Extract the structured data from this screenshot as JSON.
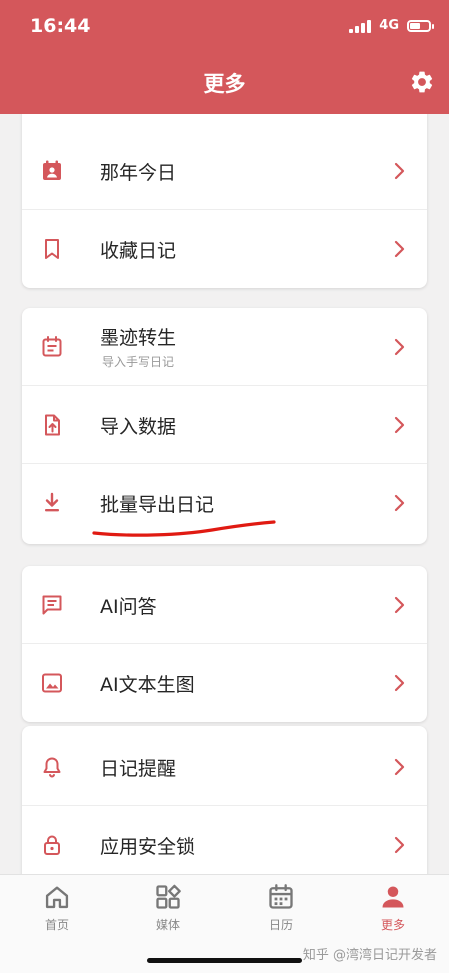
{
  "status_bar": {
    "time": "16:44",
    "network": "4G",
    "battery_level": 0.55
  },
  "header": {
    "title": "更多",
    "settings_icon": "gear-icon"
  },
  "colors": {
    "accent": "#d4575b",
    "text": "#262626",
    "secondary": "#999999",
    "background": "#f2f1f1"
  },
  "groups": [
    {
      "items": [
        {
          "label": "那年今日",
          "icon": "calendar-person-icon"
        },
        {
          "label": "收藏日记",
          "icon": "bookmark-icon"
        }
      ]
    },
    {
      "items": [
        {
          "label": "墨迹转生",
          "subtitle": "导入手写日记",
          "icon": "calendar-notes-icon"
        },
        {
          "label": "导入数据",
          "icon": "file-upload-icon"
        },
        {
          "label": "批量导出日记",
          "icon": "download-icon",
          "annotated": true
        }
      ]
    },
    {
      "items": [
        {
          "label": "AI问答",
          "icon": "chat-icon"
        },
        {
          "label": "AI文本生图",
          "icon": "image-icon"
        }
      ]
    },
    {
      "items": [
        {
          "label": "日记提醒",
          "icon": "bell-icon"
        },
        {
          "label": "应用安全锁",
          "icon": "lock-icon"
        }
      ]
    }
  ],
  "tabbar": {
    "tabs": [
      {
        "label": "首页",
        "icon": "home-icon"
      },
      {
        "label": "媒体",
        "icon": "grid-shapes-icon"
      },
      {
        "label": "日历",
        "icon": "calendar-icon"
      },
      {
        "label": "更多",
        "icon": "person-icon",
        "active": true
      }
    ]
  },
  "watermark": "知乎 @湾湾日记开发者"
}
